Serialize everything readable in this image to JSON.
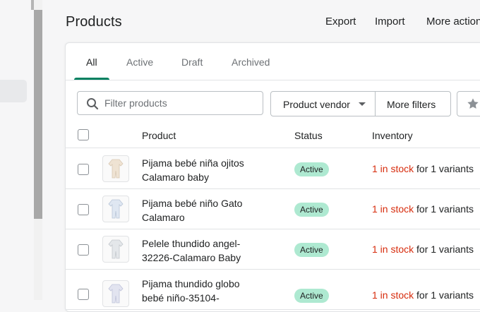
{
  "header": {
    "title": "Products",
    "actions": [
      "Export",
      "Import",
      "More actions"
    ]
  },
  "tabs": [
    "All",
    "Active",
    "Draft",
    "Archived"
  ],
  "active_tab": "All",
  "search": {
    "placeholder": "Filter products",
    "value": ""
  },
  "filters": {
    "vendor_label": "Product vendor",
    "more_label": "More filters"
  },
  "table": {
    "columns": [
      "Product",
      "Status",
      "Inventory"
    ],
    "rows": [
      {
        "name": "Pijama bebé niña ojitos Calamaro baby",
        "status": "Active",
        "stock": "1 in stock",
        "variants": "for 1 variants"
      },
      {
        "name": "Pijama bebé niño Gato Calamaro",
        "status": "Active",
        "stock": "1 in stock",
        "variants": "for 1 variants"
      },
      {
        "name": "Pelele thundido angel-32226-Calamaro Baby",
        "status": "Active",
        "stock": "1 in stock",
        "variants": "for 1 variants"
      },
      {
        "name": "Pijama thundido globo bebé niño-35104-",
        "status": "Active",
        "stock": "1 in stock",
        "variants": "for 1 variants"
      }
    ]
  },
  "colors": {
    "accent": "#008060",
    "badge_bg": "#aee9d1",
    "stock_text": "#d72c0d",
    "thumb_colors": [
      "#efe3d3",
      "#dfe7f2",
      "#e4e7ea",
      "#e2e4f0"
    ]
  },
  "icons": [
    "search-icon",
    "caret-down-icon",
    "star-icon",
    "checkbox-icon"
  ]
}
